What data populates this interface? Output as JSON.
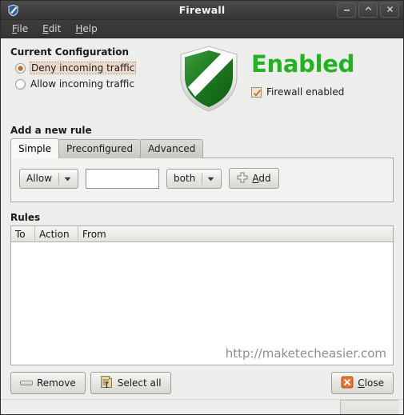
{
  "window": {
    "title": "Firewall",
    "icon": "shield-icon",
    "controls": {
      "minimize": "minimize-icon",
      "maximize": "maximize-icon",
      "close": "close-icon"
    }
  },
  "menubar": {
    "items": [
      {
        "label": "File",
        "mnemonic": "F",
        "rest": "ile"
      },
      {
        "label": "Edit",
        "mnemonic": "E",
        "rest": "dit"
      },
      {
        "label": "Help",
        "mnemonic": "H",
        "rest": "elp"
      }
    ]
  },
  "current_configuration": {
    "heading": "Current Configuration",
    "options": [
      {
        "label": "Deny incoming traffic",
        "selected": true,
        "focused": true
      },
      {
        "label": "Allow incoming traffic",
        "selected": false,
        "focused": false
      }
    ]
  },
  "status": {
    "shield_icon": "shield-status-icon",
    "state_label": "Enabled",
    "state_color": "#22b322",
    "checkbox": {
      "label": "Firewall enabled",
      "checked": true,
      "check_color": "#d2691e"
    }
  },
  "add_rule": {
    "heading": "Add a new rule",
    "tabs": [
      {
        "label": "Simple",
        "active": true
      },
      {
        "label": "Preconfigured",
        "active": false
      },
      {
        "label": "Advanced",
        "active": false
      }
    ],
    "form": {
      "action_select": {
        "value": "Allow",
        "arrow": "chevron-down-icon"
      },
      "target_input": {
        "value": "",
        "placeholder": ""
      },
      "direction_select": {
        "value": "both",
        "arrow": "chevron-down-icon"
      },
      "add_button": {
        "label": "Add",
        "mnemonic": "A",
        "rest": "dd",
        "icon": "plus-icon"
      }
    }
  },
  "rules": {
    "heading": "Rules",
    "columns": [
      "To",
      "Action",
      "From"
    ],
    "rows": [],
    "watermark": "http://maketecheasier.com"
  },
  "actions": {
    "remove": {
      "label": "Remove",
      "icon": "minus-icon"
    },
    "select_all": {
      "label": "Select all",
      "icon": "document-select-icon"
    },
    "close": {
      "label": "Close",
      "mnemonic": "C",
      "rest": "lose",
      "icon": "close-x-icon"
    }
  }
}
